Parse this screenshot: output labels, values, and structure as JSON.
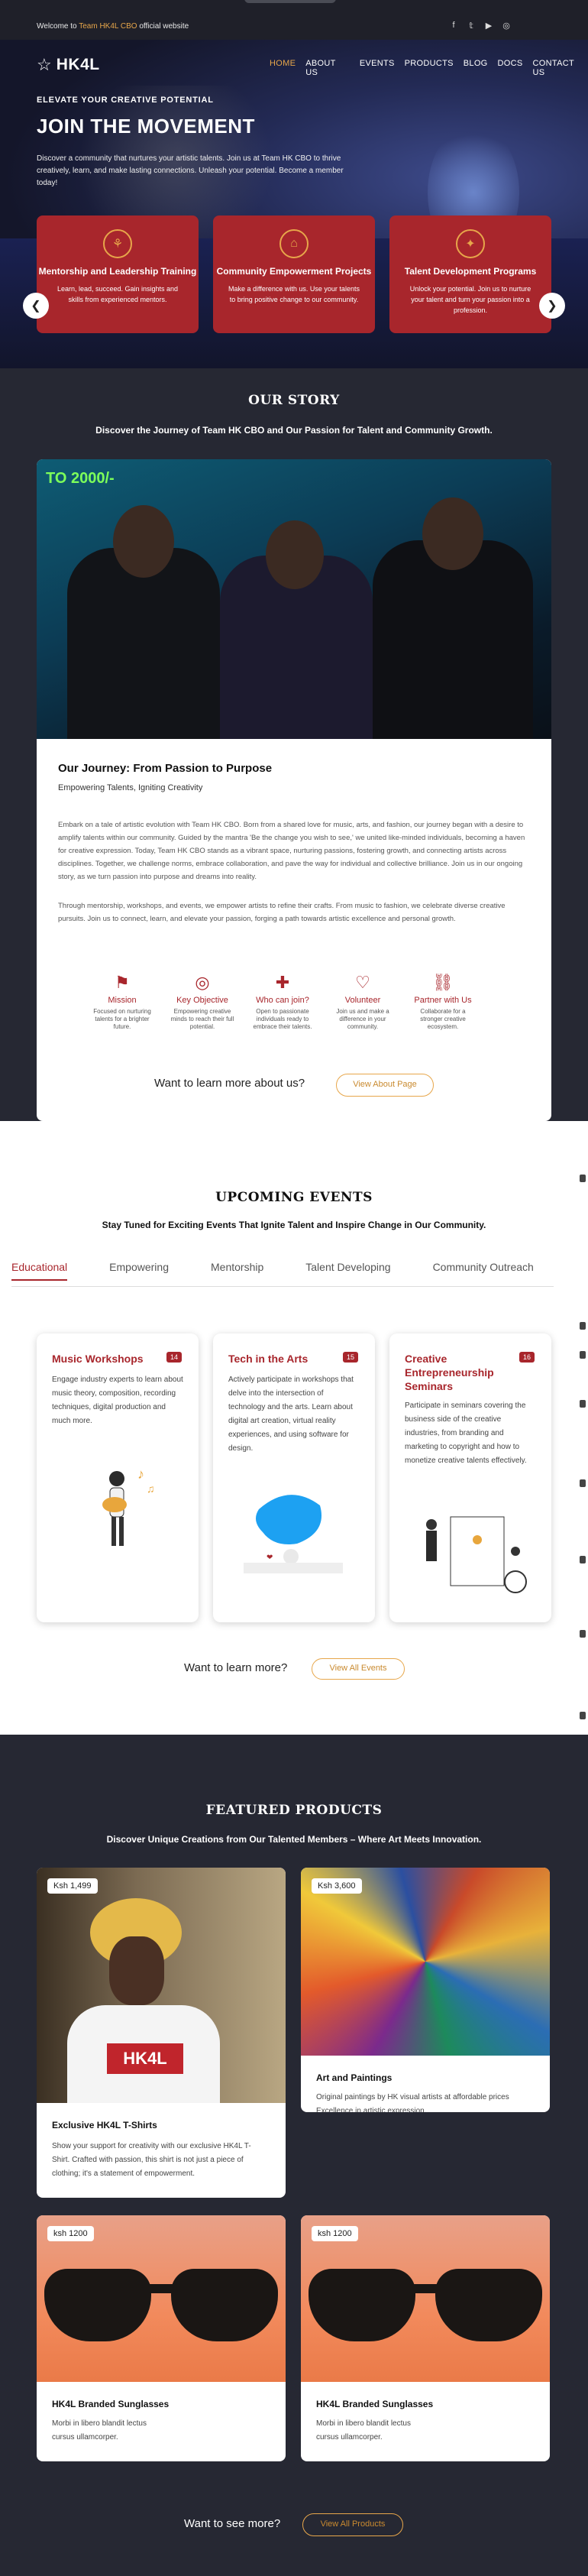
{
  "topbar": {
    "welcome_pre": "Welcome to ",
    "welcome_highlight": "Team HK4L CBO",
    "welcome_post": " official website",
    "social_icons": [
      "facebook-icon",
      "twitter-icon",
      "youtube-icon",
      "instagram-icon"
    ]
  },
  "nav": {
    "logo": "HK4L",
    "items": [
      "HOME",
      "ABOUT US",
      "EVENTS",
      "PRODUCTS",
      "BLOG",
      "DOCS",
      "CONTACT US"
    ],
    "active": "HOME"
  },
  "hero": {
    "eyebrow": "ELEVATE YOUR CREATIVE POTENTIAL",
    "title": "JOIN THE MOVEMENT",
    "text": "Discover a community that nurtures your artistic talents. Join us at Team HK CBO to thrive creatively, learn, and make lasting connections. Unleash your potential. Become a member today!",
    "cards": [
      {
        "title": "Mentorship and Leadership Training",
        "text": "Learn, lead, succeed. Gain insights and skills from experienced mentors."
      },
      {
        "title": "Community Empowerment Projects",
        "text": "Make a difference with us. Use your talents to bring positive change to our community."
      },
      {
        "title": "Talent Development Programs",
        "text": "Unlock your potential. Join us to nurture your talent and turn your passion into a profession."
      }
    ]
  },
  "story": {
    "title": "OUR STORY",
    "subtitle": "Discover the Journey of Team HK CBO and Our Passion for Talent and Community Growth.",
    "photo_sign": "TO 2000/-",
    "heading": "Our Journey: From Passion to Purpose",
    "tagline": "Empowering Talents, Igniting Creativity",
    "para1": "Embark on a tale of artistic evolution with Team HK CBO. Born from a shared love for music, arts, and fashion, our journey began with a desire to amplify talents within our community. Guided by the mantra 'Be the change you wish to see,' we united like-minded individuals, becoming a haven for creative expression. Today, Team HK CBO stands as a vibrant space, nurturing passions, fostering growth, and connecting artists across disciplines. Together, we challenge norms, embrace collaboration, and pave the way for individual and collective brilliance. Join us in our ongoing story, as we turn passion into purpose and dreams into reality.",
    "para2": "Through mentorship, workshops, and events, we empower artists to refine their crafts. From music to fashion, we celebrate diverse creative pursuits. Join us to connect, learn, and elevate your passion, forging a path towards artistic excellence and personal growth.",
    "features": [
      {
        "icon": "flag-icon",
        "label": "Mission",
        "desc": "Focused on nurturing talents for a brighter future."
      },
      {
        "icon": "bullseye-icon",
        "label": "Key Objective",
        "desc": "Empowering creative minds to reach their full potential."
      },
      {
        "icon": "user-plus-icon",
        "label": "Who can join?",
        "desc": "Open to passionate individuals ready to embrace their talents."
      },
      {
        "icon": "heart-icon",
        "label": "Volunteer",
        "desc": "Join us and make a difference in your community."
      },
      {
        "icon": "link-icon",
        "label": "Partner with Us",
        "desc": "Collaborate for a stronger creative ecosystem."
      }
    ],
    "learn_text": "Want to learn more about us?",
    "learn_button": "View About Page"
  },
  "events": {
    "title": "UPCOMING EVENTS",
    "subtitle": "Stay Tuned for Exciting Events That Ignite Talent and Inspire Change in Our Community.",
    "tabs": [
      "Educational",
      "Empowering",
      "Mentorship",
      "Talent Developing",
      "Community Outreach"
    ],
    "active_tab": "Educational",
    "cards": [
      {
        "title": "Music Workshops",
        "count": "14",
        "text": "Engage industry experts to learn about music theory, composition, recording techniques, digital production and much more."
      },
      {
        "title": "Tech in the Arts",
        "count": "15",
        "text": "Actively participate in workshops that delve into the intersection of technology and the arts. Learn about digital art creation, virtual reality experiences, and using software for design."
      },
      {
        "title": "Creative Entrepreneurship Seminars",
        "count": "16",
        "text": "Participate in seminars covering the business side of the creative industries, from branding and marketing to copyright and how to monetize creative talents effectively."
      }
    ],
    "learn_text": "Want to learn more?",
    "learn_button": "View All Events"
  },
  "products": {
    "title": "FEATURED PRODUCTS",
    "subtitle": "Discover Unique Creations from Our Talented Members – Where Art Meets Innovation.",
    "items": [
      {
        "price": "Ksh 1,499",
        "title": "Exclusive HK4L T-Shirts",
        "text": "Show your support for creativity with our exclusive HK4L T-Shirt. Crafted with passion, this shirt is not just a piece of clothing; it's a statement of empowerment.",
        "shirt_text": "HK4L"
      },
      {
        "price": "Ksh 3,600",
        "title": "Art and Paintings",
        "text": "Original paintings by HK visual artists at affordable prices Excellence in artistic expression."
      },
      {
        "price": "ksh 1200",
        "title": "HK4L Branded Sunglasses",
        "text": "Morbi in libero blandit lectus cursus ullamcorper."
      },
      {
        "price": "ksh 1200",
        "title": "HK4L Branded Sunglasses",
        "text": "Morbi in libero blandit lectus cursus ullamcorper."
      }
    ],
    "learn_text": "Want to see more?",
    "learn_button": "View All Products"
  },
  "colors": {
    "primary": "#a8262c",
    "accent": "#e7a64a",
    "dark_bg": "#262833"
  }
}
